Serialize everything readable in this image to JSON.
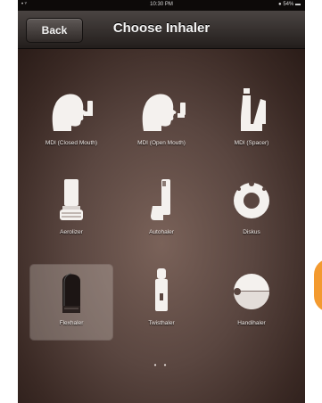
{
  "statusbar": {
    "signal": "• ᵛ",
    "time": "10:30 PM",
    "battery": "● 54% ▬"
  },
  "navbar": {
    "back_label": "Back",
    "title": "Choose Inhaler"
  },
  "items": [
    {
      "label": "MDI (Closed Mouth)",
      "icon": "mdi-closed-mouth-icon"
    },
    {
      "label": "MDI (Open Mouth)",
      "icon": "mdi-open-mouth-icon"
    },
    {
      "label": "MDI (Spacer)",
      "icon": "mdi-spacer-icon"
    },
    {
      "label": "Aerolizer",
      "icon": "aerolizer-icon"
    },
    {
      "label": "Autohaler",
      "icon": "autohaler-icon"
    },
    {
      "label": "Diskus",
      "icon": "diskus-icon"
    },
    {
      "label": "Flexhaler",
      "icon": "flexhaler-icon",
      "selected": true
    },
    {
      "label": "Twisthaler",
      "icon": "twisthaler-icon"
    },
    {
      "label": "Handihaler",
      "icon": "handihaler-icon"
    }
  ],
  "pager": {
    "indicator": "• •"
  },
  "colors": {
    "background": "#4a3731",
    "navbar": "#2f2927",
    "accent_orange": "#f39a2f"
  }
}
